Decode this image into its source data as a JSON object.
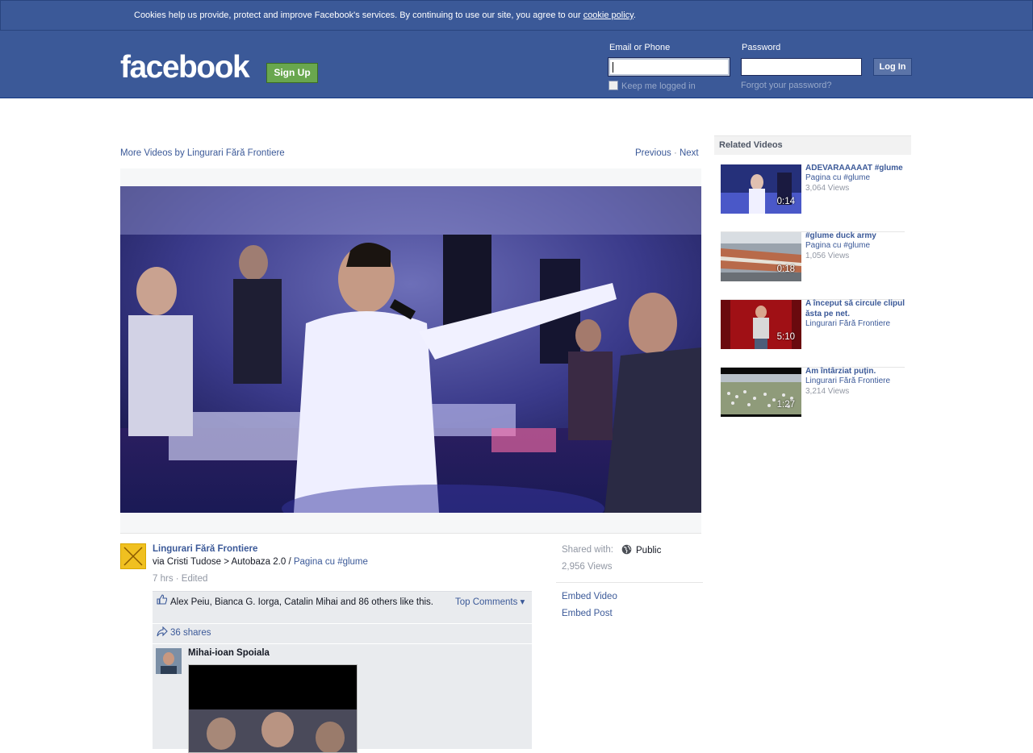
{
  "cookie": {
    "text": "Cookies help us provide, protect and improve Facebook's services. By continuing to use our site, you agree to our ",
    "link": "cookie policy",
    "end": "."
  },
  "header": {
    "logo": "facebook",
    "signup": "Sign Up",
    "email_label": "Email or Phone",
    "password_label": "Password",
    "login": "Log In",
    "keep": "Keep me logged in",
    "forgot": "Forgot your password?"
  },
  "nav": {
    "more_videos": "More Videos by Lingurari Fără Frontiere",
    "previous": "Previous",
    "sep": " · ",
    "next": "Next"
  },
  "post": {
    "author": "Lingurari Fără Frontiere",
    "via_text": "via Cristi Tudose > Autobaza 2.0 / ",
    "via_link": "Pagina cu #glume",
    "time": "7 hrs · Edited",
    "likes": "Alex Peiu, Bianca G. Iorga, Catalin Mihai and 86 others like this.",
    "top_comments": "Top Comments ▾",
    "shares": "36 shares",
    "comment_author": "Mihai-ioan Spoiala"
  },
  "side": {
    "shared_with": "Shared with:",
    "public": "Public",
    "views": "2,956 Views",
    "embed_video": "Embed Video",
    "embed_post": "Embed Post"
  },
  "related": {
    "heading": "Related Videos",
    "items": [
      {
        "title": "ADEVARAAAAAT #glume",
        "source": "Pagina cu #glume",
        "views": "3,064 Views",
        "duration": "0:14"
      },
      {
        "title": "#glume duck army",
        "source": "Pagina cu #glume",
        "views": "1,056 Views",
        "duration": "0:18"
      },
      {
        "title": "A început să circule clipul ăsta pe net.",
        "source": "Lingurari Fără Frontiere",
        "views": "",
        "duration": "5:10"
      },
      {
        "title": "Am întârziat puțin.",
        "source": "Lingurari Fără Frontiere",
        "views": "3,214 Views",
        "duration": "1:27"
      }
    ]
  },
  "icons": {
    "like": "thumbs-up-icon",
    "share": "share-arrow-icon",
    "globe": "globe-icon"
  },
  "colors": {
    "brand_blue": "#3b5998",
    "signup_green": "#69a74e",
    "link": "#3b5998",
    "muted": "#9197a3"
  }
}
